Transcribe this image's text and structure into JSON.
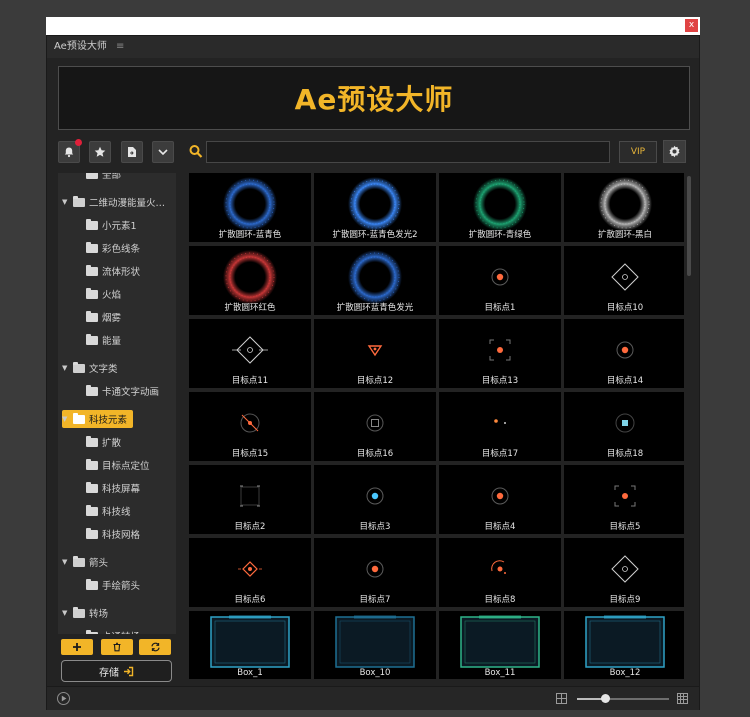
{
  "window": {
    "close_label": "x"
  },
  "panel": {
    "title": "Ae预设大师",
    "menu_icon": "≡"
  },
  "banner": {
    "title": "Ae预设大师"
  },
  "toolbar": {
    "buttons": [
      "bell-icon",
      "star-icon",
      "import-icon",
      "chevron-down-icon"
    ],
    "has_notification": true,
    "search_icon": "search-icon",
    "search_value": "",
    "vip_label": "VIP",
    "settings_icon": "gear-icon"
  },
  "sidebar": {
    "items": [
      {
        "label": "全部",
        "level": 1,
        "type": "child"
      },
      {
        "label": "二维动漫能量火…",
        "level": 0,
        "type": "folder",
        "expanded": true
      },
      {
        "label": "小元素1",
        "level": 1,
        "type": "child"
      },
      {
        "label": "彩色线条",
        "level": 1,
        "type": "child"
      },
      {
        "label": "流体形状",
        "level": 1,
        "type": "child"
      },
      {
        "label": "火焰",
        "level": 1,
        "type": "child"
      },
      {
        "label": "烟雾",
        "level": 1,
        "type": "child"
      },
      {
        "label": "能量",
        "level": 1,
        "type": "child"
      },
      {
        "label": "文字类",
        "level": 0,
        "type": "folder",
        "expanded": true
      },
      {
        "label": "卡通文字动画",
        "level": 1,
        "type": "child"
      },
      {
        "label": "科技元素",
        "level": 0,
        "type": "folder",
        "expanded": true,
        "selected": true
      },
      {
        "label": "扩散",
        "level": 1,
        "type": "child"
      },
      {
        "label": "目标点定位",
        "level": 1,
        "type": "child"
      },
      {
        "label": "科技屏幕",
        "level": 1,
        "type": "child"
      },
      {
        "label": "科技线",
        "level": 1,
        "type": "child"
      },
      {
        "label": "科技网格",
        "level": 1,
        "type": "child"
      },
      {
        "label": "箭头",
        "level": 0,
        "type": "folder",
        "expanded": true
      },
      {
        "label": "手绘箭头",
        "level": 1,
        "type": "child"
      },
      {
        "label": "转场",
        "level": 0,
        "type": "folder",
        "expanded": true
      },
      {
        "label": "卡通转场",
        "level": 1,
        "type": "child"
      }
    ],
    "actions": [
      "add-icon",
      "trash-icon",
      "refresh-icon"
    ],
    "save_label": "存储",
    "save_icon": "export-icon"
  },
  "grid": {
    "items": [
      {
        "label": "扩散圆环-蓝青色",
        "kind": "ring",
        "color": "#2f6fd6"
      },
      {
        "label": "扩散圆环-蓝青色发光2",
        "kind": "ring",
        "color": "#3d8cff"
      },
      {
        "label": "扩散圆环-青绿色",
        "kind": "ring",
        "color": "#1faa77"
      },
      {
        "label": "扩散圆环-黑白",
        "kind": "ring",
        "color": "#bdbdbd"
      },
      {
        "label": "扩散圆环红色",
        "kind": "ring",
        "color": "#d23a3a"
      },
      {
        "label": "扩散圆环蓝青色发光",
        "kind": "ring",
        "color": "#2f6fd6"
      },
      {
        "label": "目标点1",
        "kind": "dot-ring",
        "color": "#ff6a3d"
      },
      {
        "label": "目标点10",
        "kind": "diamond",
        "color": "#cfcfcf"
      },
      {
        "label": "目标点11",
        "kind": "diamond-cross",
        "color": "#cfcfcf"
      },
      {
        "label": "目标点12",
        "kind": "triangle",
        "color": "#ff6a3d"
      },
      {
        "label": "目标点13",
        "kind": "brackets",
        "color": "#ff6a3d"
      },
      {
        "label": "目标点14",
        "kind": "dot-ring",
        "color": "#ff6a3d"
      },
      {
        "label": "目标点15",
        "kind": "slash-ring",
        "color": "#ff6a3d"
      },
      {
        "label": "目标点16",
        "kind": "square-ring",
        "color": "#888888"
      },
      {
        "label": "目标点17",
        "kind": "dots",
        "color": "#ff8a3d"
      },
      {
        "label": "目标点18",
        "kind": "square-dot",
        "color": "#7fd3e6"
      },
      {
        "label": "目标点2",
        "kind": "corners",
        "color": "#888888"
      },
      {
        "label": "目标点3",
        "kind": "dot-ring",
        "color": "#4ac8ff"
      },
      {
        "label": "目标点4",
        "kind": "dot-ring",
        "color": "#ff6a3d"
      },
      {
        "label": "目标点5",
        "kind": "brackets",
        "color": "#ff6a3d"
      },
      {
        "label": "目标点6",
        "kind": "diamond-small",
        "color": "#ff6a3d"
      },
      {
        "label": "目标点7",
        "kind": "dot-ring",
        "color": "#ff6a3d"
      },
      {
        "label": "目标点8",
        "kind": "arc-dot",
        "color": "#ff6a3d"
      },
      {
        "label": "目标点9",
        "kind": "diamond",
        "color": "#cfcfcf"
      },
      {
        "label": "Box_1",
        "kind": "box",
        "color": "#2fa3c7"
      },
      {
        "label": "Box_10",
        "kind": "box",
        "color": "#1e6f93"
      },
      {
        "label": "Box_11",
        "kind": "box",
        "color": "#2fb58a"
      },
      {
        "label": "Box_12",
        "kind": "box",
        "color": "#2fa3c7"
      }
    ]
  },
  "bottombar": {
    "play_icon": "play-icon",
    "grid_small_icon": "grid-small-icon",
    "zoom_level": 0.3,
    "grid_large_icon": "grid-large-icon"
  },
  "colors": {
    "accent": "#f2b528",
    "background": "#232323",
    "notification": "#e0203a"
  }
}
